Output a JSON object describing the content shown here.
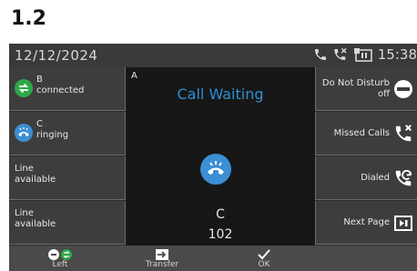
{
  "section_title": "1.2",
  "status": {
    "date": "12/12/2024",
    "time": "15:38"
  },
  "lines": [
    {
      "name": "B",
      "state": "connected",
      "color": "#2ea84a"
    },
    {
      "name": "C",
      "state": "ringing",
      "color": "#3c8fd4"
    },
    {
      "text1": "Line",
      "text2": "available"
    },
    {
      "text1": "Line",
      "text2": "available"
    }
  ],
  "center": {
    "account": "A",
    "title": "Call Waiting",
    "caller_name": "C",
    "caller_number": "102"
  },
  "right_keys": [
    {
      "label1": "Do Not Disturb",
      "label2": "off",
      "icon": "dnd-icon"
    },
    {
      "label1": "Missed Calls",
      "label2": "",
      "icon": "missed-calls-icon"
    },
    {
      "label1": "Dialed",
      "label2": "",
      "icon": "dialed-icon"
    },
    {
      "label1": "Next Page",
      "label2": "",
      "icon": "next-page-icon"
    }
  ],
  "softkeys": [
    {
      "label": "Left",
      "icon": "left-line-icon"
    },
    {
      "label": "Transfer",
      "icon": "transfer-icon"
    },
    {
      "label": "OK",
      "icon": "check-icon"
    },
    {
      "label": "",
      "icon": ""
    }
  ],
  "colors": {
    "accent": "#2f8fd6",
    "green": "#2ea84a",
    "blue": "#3c8fd4"
  }
}
